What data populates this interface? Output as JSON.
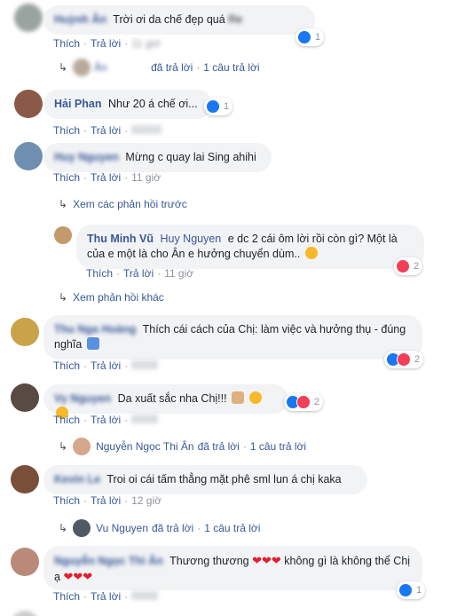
{
  "labels": {
    "like": "Thích",
    "reply": "Trả lời",
    "replied": "đã trả lời",
    "dot": "·",
    "one_reply": "1 câu trả lời",
    "view_previous": "Xem các phản hồi trước",
    "view_more": "Xem phản hồi khác"
  },
  "comments": [
    {
      "author": "Huỳnh Ân",
      "text": "Trời ơi da chế đẹp quá",
      "text_suffix": "Re",
      "time": "11 giờ",
      "reactions": "1",
      "reply_author": "Ân",
      "reply_count_text": "1 câu trả lời"
    },
    {
      "author": "Hải Phan",
      "text": "Như 20 á chế ơi...",
      "time": "",
      "reactions": "1"
    },
    {
      "author": "Huy Nguyen",
      "text": "Mừng c quay lai Sing ahihi",
      "time": "11 giờ"
    },
    {
      "author": "Thu Minh Vũ",
      "mention": "Huy Nguyen",
      "text": "e dc 2 cái ôm lời rồi còn gì? Một là của e một là cho Ân e hưởng chuyển dùm..",
      "time": "11 giờ",
      "reactions": "2"
    },
    {
      "author": "Thu Nga Hoàng",
      "text": "Thích cái cách của Chị: làm việc và hưởng thụ - đúng nghĩa",
      "time": "",
      "reactions": "2"
    },
    {
      "author": "Vy Nguyen",
      "text": "Da xuất sắc nha Chị!!!",
      "time": "",
      "reactions": "2",
      "reply_author": "Nguyễn Ngọc Thi Ân",
      "reply_count_text": "1 câu trả lời"
    },
    {
      "author": "Kevin Le",
      "text": "Troi oi cái tấm thẳng mặt phê sml lun á chị kaka",
      "time": "12 giờ",
      "reply_author": "Vu Nguyen",
      "reply_count_text": "1 câu trả lời"
    },
    {
      "author": "Nguyễn Ngọc Thi Ân",
      "text": "Thương thương",
      "text2": "không gì là không thể Chị ạ",
      "time": "",
      "reactions": "1"
    }
  ],
  "colors": {
    "link": "#385898",
    "bubble": "#f2f3f5",
    "meta": "#90949c",
    "like": "#1877f2",
    "love": "#f33e58"
  }
}
